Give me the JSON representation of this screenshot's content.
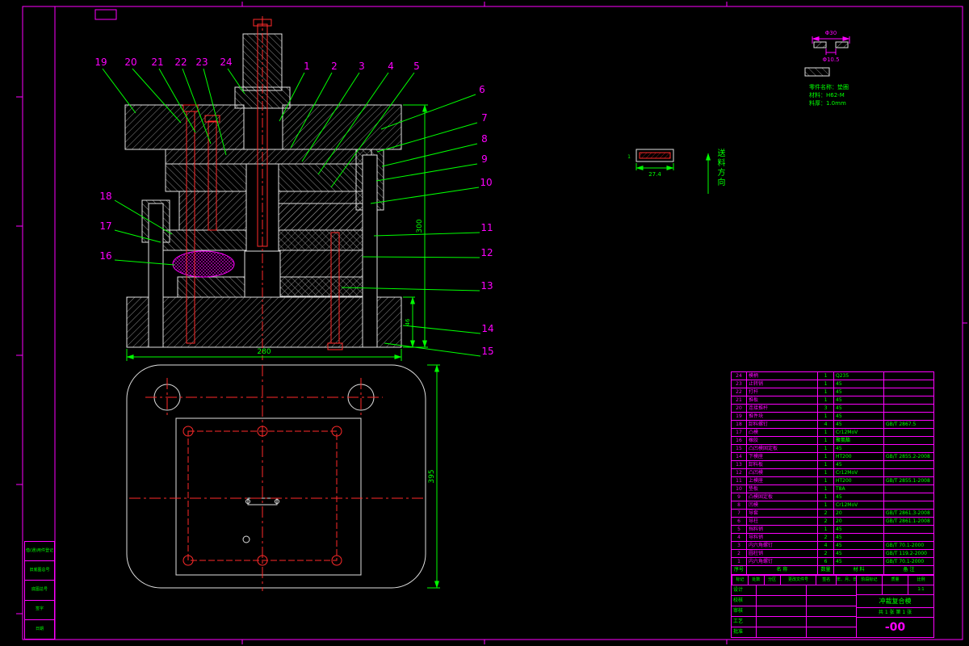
{
  "sheet": {
    "colors": {
      "frame": "#FF00FF",
      "outline": "#E0E0E0",
      "leader": "#00FF00",
      "centerline": "#FF2A2A"
    }
  },
  "callouts": [
    "1",
    "2",
    "3",
    "4",
    "5",
    "6",
    "7",
    "8",
    "9",
    "10",
    "11",
    "12",
    "13",
    "14",
    "15",
    "16",
    "17",
    "18",
    "19",
    "20",
    "21",
    "22",
    "23",
    "24"
  ],
  "dims": {
    "section_width": "280",
    "section_height": "300",
    "lower_holder_thickness": "46",
    "plan_height": "395"
  },
  "detail_a": {
    "dim_outer": "Φ30",
    "dim_inner": "Φ10.5",
    "note1": "零件名称：垫圈",
    "note2": "材料：H62-M",
    "note3": "料厚：1.0mm"
  },
  "detail_b": {
    "dim_width": "27.4",
    "dim_thickness": "1"
  },
  "feed_direction": "送料方向",
  "bom": {
    "header": {
      "no": "序号",
      "name": "名  称",
      "qty": "数量",
      "material": "材  料",
      "note": "备  注"
    },
    "rows": [
      {
        "no": "24",
        "name": "模柄",
        "qty": "1",
        "material": "Q235",
        "note": ""
      },
      {
        "no": "23",
        "name": "止转销",
        "qty": "1",
        "material": "45",
        "note": ""
      },
      {
        "no": "22",
        "name": "打杆",
        "qty": "1",
        "material": "45",
        "note": ""
      },
      {
        "no": "21",
        "name": "推板",
        "qty": "1",
        "material": "45",
        "note": ""
      },
      {
        "no": "20",
        "name": "连接推杆",
        "qty": "3",
        "material": "45",
        "note": ""
      },
      {
        "no": "19",
        "name": "推件块",
        "qty": "1",
        "material": "45",
        "note": ""
      },
      {
        "no": "18",
        "name": "卸料螺钉",
        "qty": "4",
        "material": "45",
        "note": "GB/T 2867.5"
      },
      {
        "no": "17",
        "name": "凸模",
        "qty": "1",
        "material": "Cr12MoV",
        "note": ""
      },
      {
        "no": "16",
        "name": "橡胶",
        "qty": "1",
        "material": "聚氨酯",
        "note": ""
      },
      {
        "no": "15",
        "name": "凸凹模固定板",
        "qty": "1",
        "material": "45",
        "note": ""
      },
      {
        "no": "14",
        "name": "下模座",
        "qty": "1",
        "material": "HT200",
        "note": "GB/T 2855.2-2008"
      },
      {
        "no": "13",
        "name": "卸料板",
        "qty": "1",
        "material": "45",
        "note": ""
      },
      {
        "no": "12",
        "name": "凸凹模",
        "qty": "1",
        "material": "Cr12MoV",
        "note": ""
      },
      {
        "no": "11",
        "name": "上模座",
        "qty": "1",
        "material": "HT200",
        "note": "GB/T 2855.1-2008"
      },
      {
        "no": "10",
        "name": "垫板",
        "qty": "1",
        "material": "T8A",
        "note": ""
      },
      {
        "no": "9",
        "name": "凸模固定板",
        "qty": "1",
        "material": "45",
        "note": ""
      },
      {
        "no": "8",
        "name": "凹模",
        "qty": "1",
        "material": "Cr12MoV",
        "note": ""
      },
      {
        "no": "7",
        "name": "导套",
        "qty": "2",
        "material": "20",
        "note": "GB/T 2861.3-2008"
      },
      {
        "no": "6",
        "name": "导柱",
        "qty": "2",
        "material": "20",
        "note": "GB/T 2861.1-2008"
      },
      {
        "no": "5",
        "name": "挡料销",
        "qty": "1",
        "material": "45",
        "note": ""
      },
      {
        "no": "4",
        "name": "导料销",
        "qty": "2",
        "material": "45",
        "note": ""
      },
      {
        "no": "3",
        "name": "内六角螺钉",
        "qty": "4",
        "material": "45",
        "note": "GB/T 70.1-2000"
      },
      {
        "no": "2",
        "name": "圆柱销",
        "qty": "2",
        "material": "45",
        "note": "GB/T 119.2-2000"
      },
      {
        "no": "1",
        "name": "内六角螺钉",
        "qty": "6",
        "material": "45",
        "note": "GB/T 70.1-2000"
      }
    ]
  },
  "title_block": {
    "revision_cols": [
      "标记",
      "处数",
      "分区",
      "更改文件号",
      "签名",
      "年、月、日"
    ],
    "sign_rows": [
      {
        "label": "设计"
      },
      {
        "label": "校核"
      },
      {
        "label": "审核"
      },
      {
        "label": "工艺"
      },
      {
        "label": "批准"
      }
    ],
    "stage_cols": [
      "阶段标记",
      "质量",
      "比例"
    ],
    "scale": "1:1",
    "title": "冲裁复合模",
    "sheet": "共 1 张  第 1 张",
    "drawing_number": "-00"
  },
  "margin_strip": {
    "cells": [
      "借(通)用件登记",
      "旧底图总号",
      "底图总号",
      "签字",
      "日期"
    ]
  }
}
